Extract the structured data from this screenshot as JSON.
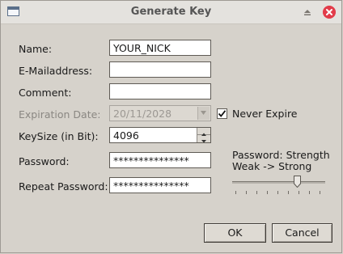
{
  "window": {
    "title": "Generate Key"
  },
  "form": {
    "name_label": "Name:",
    "name_value": "YOUR_NICK",
    "email_label": "E-Mailaddress:",
    "email_value": "",
    "comment_label": "Comment:",
    "comment_value": "",
    "expiration_label": "Expiration Date:",
    "expiration_value": "20/11/2028",
    "never_expire_label": "Never Expire",
    "never_expire_checked": true,
    "keysize_label": "KeySize (in Bit):",
    "keysize_value": "4096",
    "password_label": "Password:",
    "password_value": "***************",
    "repeat_password_label": "Repeat Password:",
    "repeat_password_value": "***************"
  },
  "strength": {
    "title": "Password: Strength",
    "subtitle": "Weak -> Strong",
    "level": 0.7
  },
  "buttons": {
    "ok_label": "OK",
    "cancel_label": "Cancel"
  },
  "icons": {
    "window": "window-icon",
    "maximize": "maximize-icon",
    "close": "close-icon"
  },
  "colors": {
    "close_button": "#e23c4a",
    "dialog_background": "#d6d2cb"
  }
}
